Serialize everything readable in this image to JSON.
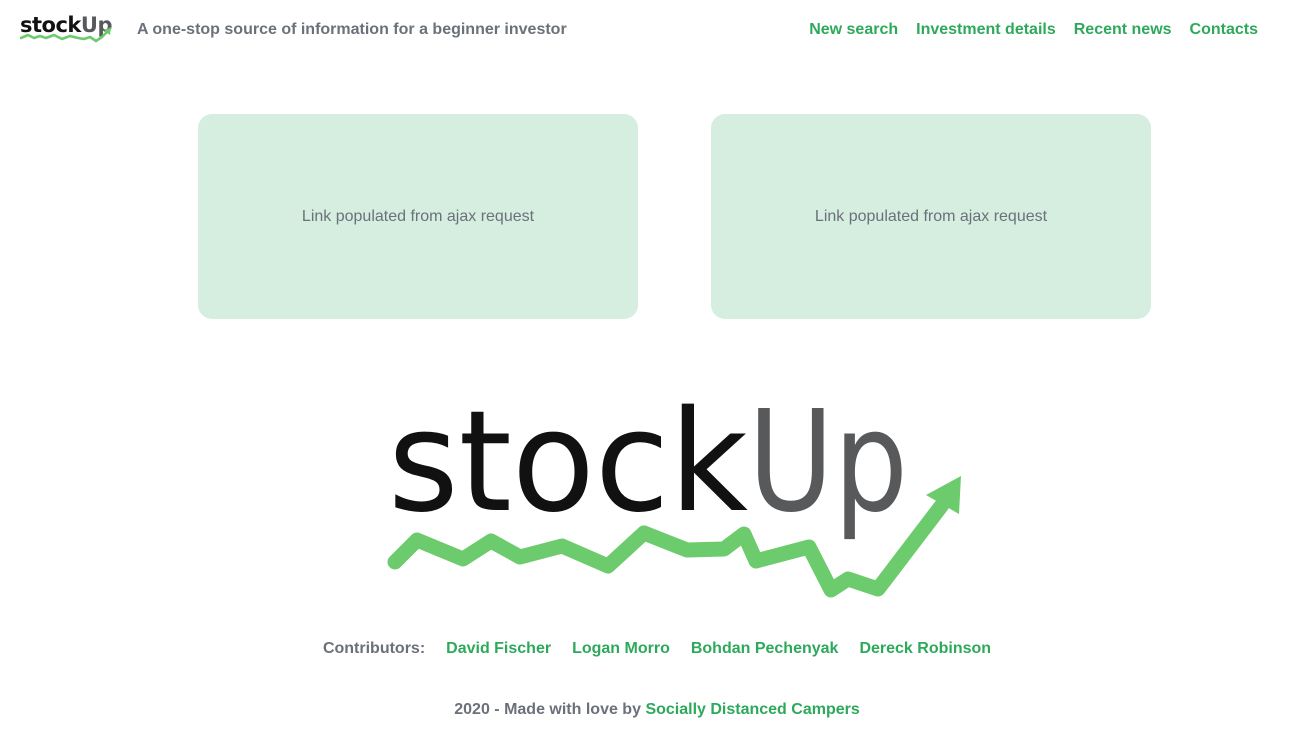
{
  "brand": {
    "logo_text": "stockUp",
    "tagline": "A one-stop source of information for a beginner investor",
    "colors": {
      "green": "#2ea95c",
      "chart_green": "#6ccb6c",
      "card_bg": "#d5eee0",
      "text_gray": "#6b717a",
      "logo_gray": "#58595b",
      "logo_black": "#111111"
    }
  },
  "nav": {
    "items": [
      "New search",
      "Investment details",
      "Recent news",
      "Contacts"
    ]
  },
  "cards": [
    {
      "text": "Link populated from ajax request"
    },
    {
      "text": "Link populated from ajax request"
    }
  ],
  "contributors": {
    "label": "Contributors:",
    "names": [
      "David Fischer",
      "Logan Morro",
      "Bohdan Pechenyak",
      "Dereck Robinson"
    ]
  },
  "footer": {
    "text": "2020 - Made with love by",
    "link": "Socially Distanced Campers"
  }
}
